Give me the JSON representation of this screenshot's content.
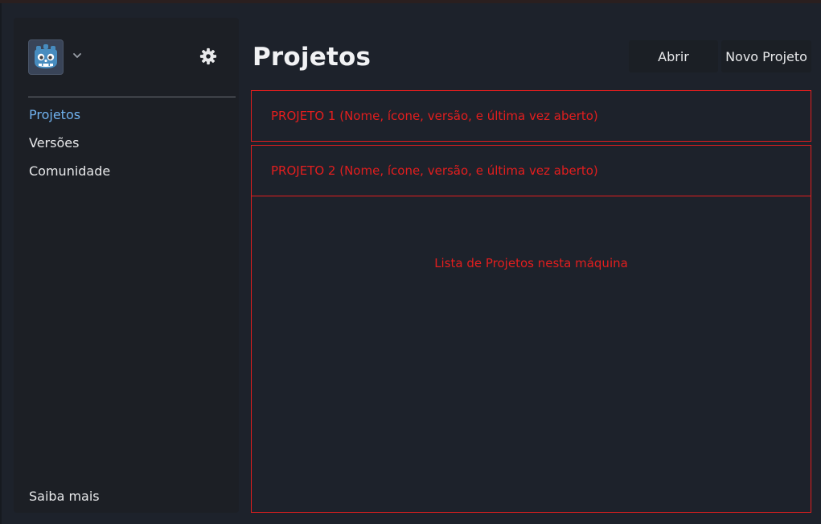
{
  "sidebar": {
    "logo_icon": "godot-robot-icon",
    "dropdown_icon": "chevron-down-icon",
    "settings_icon": "gear-icon",
    "nav": [
      {
        "label": "Projetos",
        "active": true
      },
      {
        "label": "Versões",
        "active": false
      },
      {
        "label": "Comunidade",
        "active": false
      }
    ],
    "footer_link": "Saiba mais"
  },
  "main": {
    "title": "Projetos",
    "buttons": {
      "open": "Abrir",
      "new_project": "Novo Projeto"
    },
    "projects": [
      {
        "label": "PROJETO 1 (Nome, ícone, versão, e última vez aberto)"
      },
      {
        "label": "PROJETO 2 (Nome, ícone, versão, e última vez aberto)"
      }
    ],
    "list_caption": "Lista de Projetos nesta máquina"
  },
  "colors": {
    "background": "#1d222b",
    "sidebar": "#1c1f25",
    "accent_active": "#70b2ef",
    "annotation_red": "#e31e1e",
    "logo_blue": "#478cbf"
  }
}
